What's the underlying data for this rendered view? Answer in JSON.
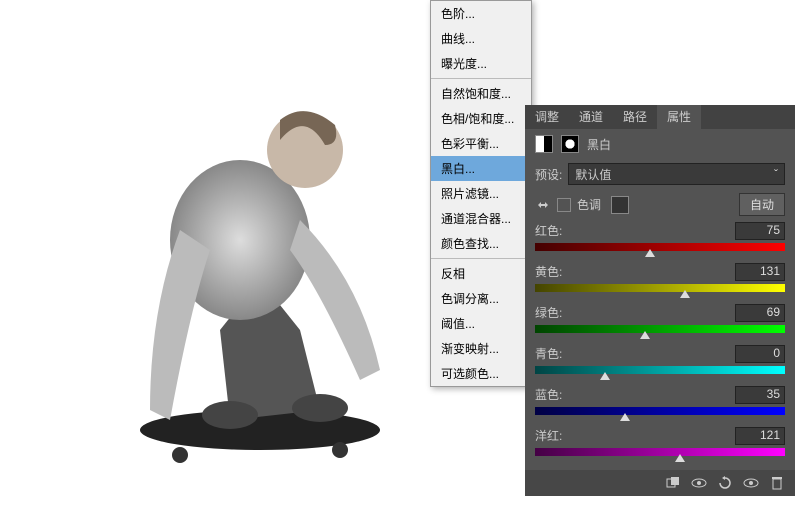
{
  "menu": {
    "items": [
      {
        "label": "色阶...",
        "arrow": false
      },
      {
        "label": "曲线...",
        "arrow": false
      },
      {
        "label": "曝光度...",
        "arrow": false
      },
      {
        "sep": true
      },
      {
        "label": "自然饱和度...",
        "arrow": false
      },
      {
        "label": "色相/饱和度...",
        "arrow": false
      },
      {
        "label": "色彩平衡...",
        "arrow": false
      },
      {
        "label": "黑白...",
        "arrow": false,
        "selected": true
      },
      {
        "label": "照片滤镜...",
        "arrow": false
      },
      {
        "label": "通道混合器...",
        "arrow": false
      },
      {
        "label": "颜色查找...",
        "arrow": false
      },
      {
        "sep": true
      },
      {
        "label": "反相",
        "arrow": false
      },
      {
        "label": "色调分离...",
        "arrow": false
      },
      {
        "label": "阈值...",
        "arrow": false
      },
      {
        "label": "渐变映射...",
        "arrow": false
      },
      {
        "label": "可选颜色...",
        "arrow": false
      }
    ]
  },
  "tabs": [
    "调整",
    "通道",
    "路径",
    "属性"
  ],
  "active_tab": "属性",
  "panel_title": "黑白",
  "preset_label": "预设:",
  "preset_value": "默认值",
  "tint_label": "色调",
  "auto_label": "自动",
  "sliders": [
    {
      "name": "红色:",
      "value": 75,
      "grad": "linear-gradient(90deg,#400,#f00)",
      "pos": 46
    },
    {
      "name": "黄色:",
      "value": 131,
      "grad": "linear-gradient(90deg,#440,#ff0)",
      "pos": 60
    },
    {
      "name": "绿色:",
      "value": 69,
      "grad": "linear-gradient(90deg,#040,#0f0)",
      "pos": 44
    },
    {
      "name": "青色:",
      "value": 0,
      "grad": "linear-gradient(90deg,#044,#0ff)",
      "pos": 28
    },
    {
      "name": "蓝色:",
      "value": 35,
      "grad": "linear-gradient(90deg,#004,#00f)",
      "pos": 36
    },
    {
      "name": "洋红:",
      "value": 121,
      "grad": "linear-gradient(90deg,#404,#f0f)",
      "pos": 58
    }
  ],
  "chart_data": {
    "type": "table",
    "title": "黑白调整",
    "series": [
      {
        "name": "通道",
        "values": [
          "红色",
          "黄色",
          "绿色",
          "青色",
          "蓝色",
          "洋红"
        ]
      }
    ],
    "values": [
      75,
      131,
      69,
      0,
      35,
      121
    ]
  }
}
